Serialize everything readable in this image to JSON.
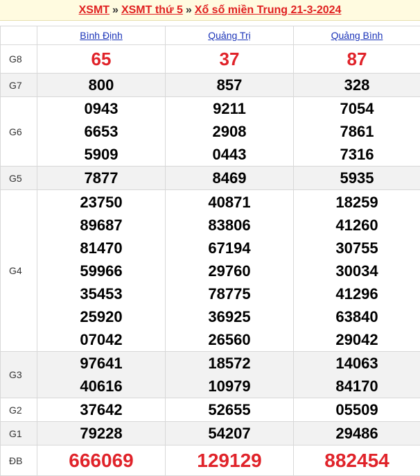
{
  "breadcrumb": {
    "home": "XSMT",
    "weekday": "XSMT thứ 5",
    "current": "Xổ số miền Trung 21-3-2024",
    "separator": "»"
  },
  "provinces": [
    "Bình Định",
    "Quảng Trị",
    "Quảng Bình"
  ],
  "prizes": [
    {
      "label": "G8",
      "values": [
        [
          "65"
        ],
        [
          "37"
        ],
        [
          "87"
        ]
      ]
    },
    {
      "label": "G7",
      "values": [
        [
          "800"
        ],
        [
          "857"
        ],
        [
          "328"
        ]
      ]
    },
    {
      "label": "G6",
      "values": [
        [
          "0943",
          "6653",
          "5909"
        ],
        [
          "9211",
          "2908",
          "0443"
        ],
        [
          "7054",
          "7861",
          "7316"
        ]
      ]
    },
    {
      "label": "G5",
      "values": [
        [
          "7877"
        ],
        [
          "8469"
        ],
        [
          "5935"
        ]
      ]
    },
    {
      "label": "G4",
      "values": [
        [
          "23750",
          "89687",
          "81470",
          "59966",
          "35453",
          "25920",
          "07042"
        ],
        [
          "40871",
          "83806",
          "67194",
          "29760",
          "78775",
          "36925",
          "26560"
        ],
        [
          "18259",
          "41260",
          "30755",
          "30034",
          "41296",
          "63840",
          "29042"
        ]
      ]
    },
    {
      "label": "G3",
      "values": [
        [
          "97641",
          "40616"
        ],
        [
          "18572",
          "10979"
        ],
        [
          "14063",
          "84170"
        ]
      ]
    },
    {
      "label": "G2",
      "values": [
        [
          "37642"
        ],
        [
          "52655"
        ],
        [
          "05509"
        ]
      ]
    },
    {
      "label": "G1",
      "values": [
        [
          "79228"
        ],
        [
          "54207"
        ],
        [
          "29486"
        ]
      ]
    },
    {
      "label": "ĐB",
      "values": [
        [
          "666069"
        ],
        [
          "129129"
        ],
        [
          "882454"
        ]
      ]
    }
  ],
  "colors": {
    "accent_red": "#e0232a",
    "link_blue": "#1a33b8",
    "row_alt": "#f2f2f2",
    "header_bg": "#fffbe0"
  }
}
